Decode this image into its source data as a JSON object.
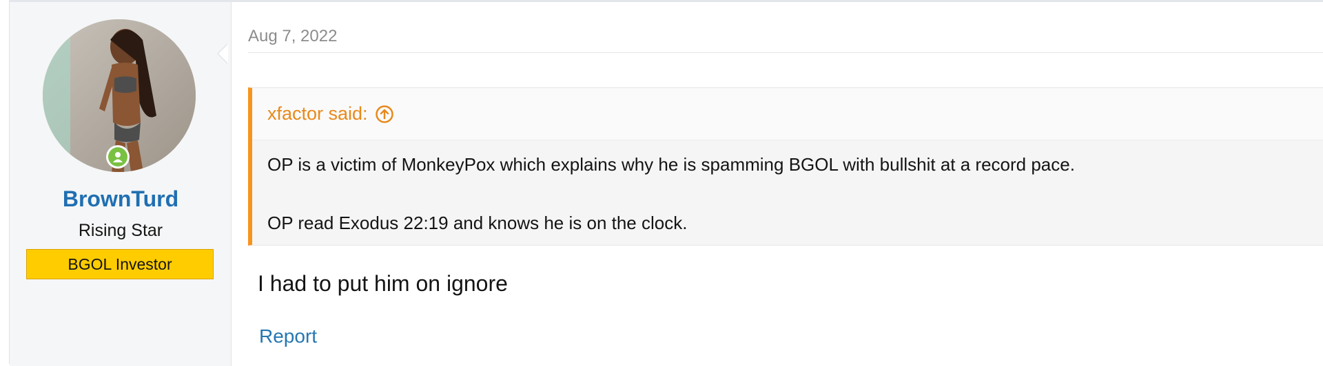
{
  "post": {
    "date": "Aug 7, 2022",
    "message": "I had to put him on ignore",
    "report_label": "Report"
  },
  "user": {
    "name": "BrownTurd",
    "title": "Rising Star",
    "banner": "BGOL Investor",
    "avatar_icon": "user-avatar-photo",
    "online_icon": "online-status-icon"
  },
  "quote": {
    "author_label": "xfactor said:",
    "jump_icon": "arrow-up-circle-icon",
    "lines": [
      "OP is a victim of MonkeyPox which explains why he is spamming BGOL with bullshit at a record pace.",
      "OP read Exodus 22:19 and knows he is on the clock."
    ]
  },
  "colors": {
    "username": "#1f6fb2",
    "quote_accent": "#f7941d",
    "banner_bg": "#ffcc00",
    "online": "#7ac143",
    "link": "#2577b1"
  }
}
